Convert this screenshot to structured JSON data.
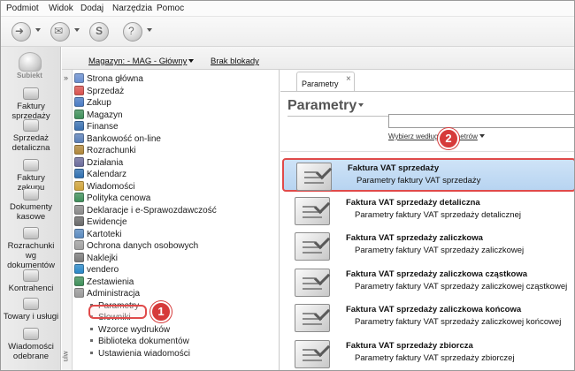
{
  "menu": [
    "Podmiot",
    "Widok",
    "Dodaj",
    "Narzędzia",
    "Pomoc"
  ],
  "toolbar": {
    "buttons": [
      {
        "icon": "circle-arrow-icon"
      },
      {
        "icon": "envelope-icon"
      },
      {
        "icon": "s-logo-icon"
      },
      {
        "icon": "search-help-icon"
      }
    ]
  },
  "leftnav": {
    "logo_text": "Subiekt",
    "items": [
      {
        "label": "Faktury sprzedaży"
      },
      {
        "label": "Sprzedaż detaliczna"
      },
      {
        "label": "Faktury zakupu"
      },
      {
        "label": "Dokumenty kasowe"
      },
      {
        "label": "Rozrachunki wg dokumentów"
      },
      {
        "label": "Kontrahenci"
      },
      {
        "label": "Towary i usługi"
      },
      {
        "label": "Wiadomości odebrane"
      }
    ]
  },
  "header": {
    "magazyn": "Magazyn: - MAG - Główny",
    "blokady": "Brak blokady"
  },
  "strip_text": "ulw",
  "tree": {
    "items": [
      {
        "label": "Strona główna",
        "color": "#6a8fd0"
      },
      {
        "label": "Sprzedaż",
        "color": "#d9534f"
      },
      {
        "label": "Zakup",
        "color": "#4a7bc4"
      },
      {
        "label": "Magazyn",
        "color": "#3f8f5a"
      },
      {
        "label": "Finanse",
        "color": "#3a70b0"
      },
      {
        "label": "Bankowość on-line",
        "color": "#5a7fb8"
      },
      {
        "label": "Rozrachunki",
        "color": "#b0873a"
      },
      {
        "label": "Działania",
        "color": "#6b6b9b"
      },
      {
        "label": "Kalendarz",
        "color": "#2f6fb0"
      },
      {
        "label": "Wiadomości",
        "color": "#cfa33a"
      },
      {
        "label": "Polityka cenowa",
        "color": "#3f8f5a"
      },
      {
        "label": "Deklaracje i e-Sprawozdawczość",
        "color": "#8a8a8a"
      },
      {
        "label": "Ewidencje",
        "color": "#6a6a6a"
      },
      {
        "label": "Kartoteki",
        "color": "#5a8ac0"
      },
      {
        "label": "Ochrona danych osobowych",
        "color": "#a0a0a0"
      },
      {
        "label": "Naklejki",
        "color": "#7a7a7a"
      },
      {
        "label": "vendero",
        "color": "#2a88c8"
      },
      {
        "label": "Zestawienia",
        "color": "#3f8f5a"
      },
      {
        "label": "Administracja",
        "color": "#9a9a9a"
      }
    ],
    "sub_items": [
      {
        "label": "Parametry"
      },
      {
        "label": "Słowniki"
      },
      {
        "label": "Wzorce wydruków"
      },
      {
        "label": "Biblioteka dokumentów"
      },
      {
        "label": "Ustawienia wiadomości"
      }
    ]
  },
  "content": {
    "tab_label": "Parametry",
    "tab_close": "×",
    "title": "Parametry",
    "search_value": "",
    "search_link": "Wybierz według parametrów",
    "list": [
      {
        "title": "Faktura VAT sprzedaży",
        "subtitle": "Parametry faktury VAT sprzedaży"
      },
      {
        "title": "Faktura VAT sprzedaży detaliczna",
        "subtitle": "Parametry faktury VAT sprzedaży detalicznej"
      },
      {
        "title": "Faktura VAT sprzedaży zaliczkowa",
        "subtitle": "Parametry faktury VAT sprzedaży zaliczkowej"
      },
      {
        "title": "Faktura VAT sprzedaży zaliczkowa cząstkowa",
        "subtitle": "Parametry faktury VAT sprzedaży zaliczkowej cząstkowej"
      },
      {
        "title": "Faktura VAT sprzedaży zaliczkowa końcowa",
        "subtitle": "Parametry faktury VAT sprzedaży zaliczkowej końcowej"
      },
      {
        "title": "Faktura VAT sprzedaży zbiorcza",
        "subtitle": "Parametry faktury VAT sprzedaży zbiorczej"
      }
    ]
  },
  "callouts": [
    "1",
    "2"
  ],
  "colors": {
    "selected_bg": "#b7d4f1",
    "highlight_border": "#e04a4a",
    "callout": "#d63a3a"
  }
}
